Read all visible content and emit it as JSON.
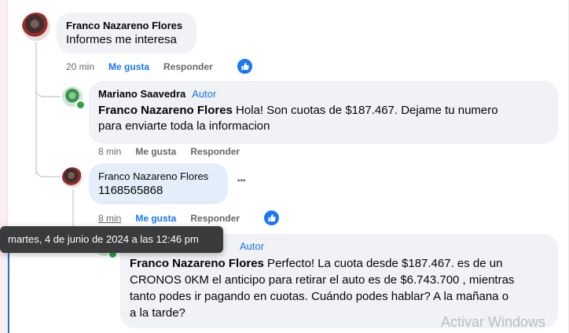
{
  "comment_main": {
    "author": "Franco Nazareno Flores",
    "text": "Informes me interesa",
    "time": "20 min",
    "like_label": "Me gusta",
    "reply_label": "Responder"
  },
  "reply1": {
    "author": "Mariano Saavedra",
    "tag": "Autor",
    "mention": "Franco Nazareno Flores",
    "text_line1": " Hola! Son cuotas de $187.467. Dejame tu numero",
    "text_line2": "para enviarte toda la informacion",
    "time": "8 min",
    "like_label": "Me gusta",
    "reply_label": "Responder"
  },
  "reply2": {
    "author": "Franco Nazareno Flores",
    "text": "1168565868",
    "time": "8 min",
    "like_label": "Me gusta",
    "reply_label": "Responder",
    "more": "•••"
  },
  "reply3": {
    "tag": "Autor",
    "mention": "Franco Nazareno Flores",
    "text_line1": " Perfecto! La cuota desde $187.467. es de un",
    "text_line2": "CRONOS 0KM el anticipo para retirar el auto es de $6.743.700 , mientras",
    "text_line3": "tanto podes ir pagando en cuotas. Cuándo podes hablar? A la mañana o",
    "text_line4": "a la tarde?"
  },
  "tooltip": "martes, 4 de junio de 2024 a las 12:46 pm",
  "watermark": "Activar Windows",
  "colors": {
    "accent": "#1877f2",
    "bubble": "#f0f2f5",
    "online": "#31a24c"
  }
}
